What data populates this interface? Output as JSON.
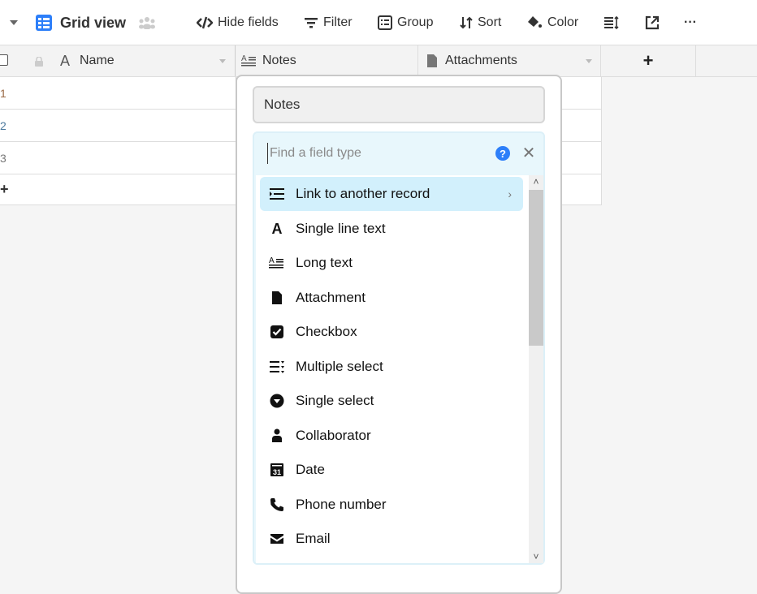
{
  "toolbar": {
    "view_name": "Grid view",
    "hide_fields": "Hide fields",
    "filter": "Filter",
    "group": "Group",
    "sort": "Sort",
    "color": "Color",
    "more": "···"
  },
  "grid": {
    "columns": [
      {
        "label": "Name",
        "icon": "single-line-text-icon"
      },
      {
        "label": "Notes",
        "icon": "long-text-icon"
      },
      {
        "label": "Attachments",
        "icon": "attachment-icon"
      }
    ],
    "add_column": "+",
    "rows": [
      "1",
      "2",
      "3"
    ],
    "add_row": "+"
  },
  "popup": {
    "field_name": "Notes",
    "search_placeholder": "Find a field type",
    "help": "?",
    "close": "✕",
    "field_types": [
      {
        "label": "Link to another record",
        "icon": "link-record-icon",
        "active": true
      },
      {
        "label": "Single line text",
        "icon": "single-line-text-icon"
      },
      {
        "label": "Long text",
        "icon": "long-text-icon"
      },
      {
        "label": "Attachment",
        "icon": "attachment-icon"
      },
      {
        "label": "Checkbox",
        "icon": "checkbox-icon"
      },
      {
        "label": "Multiple select",
        "icon": "multiple-select-icon"
      },
      {
        "label": "Single select",
        "icon": "single-select-icon"
      },
      {
        "label": "Collaborator",
        "icon": "collaborator-icon"
      },
      {
        "label": "Date",
        "icon": "date-icon"
      },
      {
        "label": "Phone number",
        "icon": "phone-icon"
      },
      {
        "label": "Email",
        "icon": "email-icon"
      }
    ]
  },
  "colors": {
    "accent": "#2d7ff9",
    "active_item": "#d2f0fc",
    "panel": "#e8f7fc"
  }
}
